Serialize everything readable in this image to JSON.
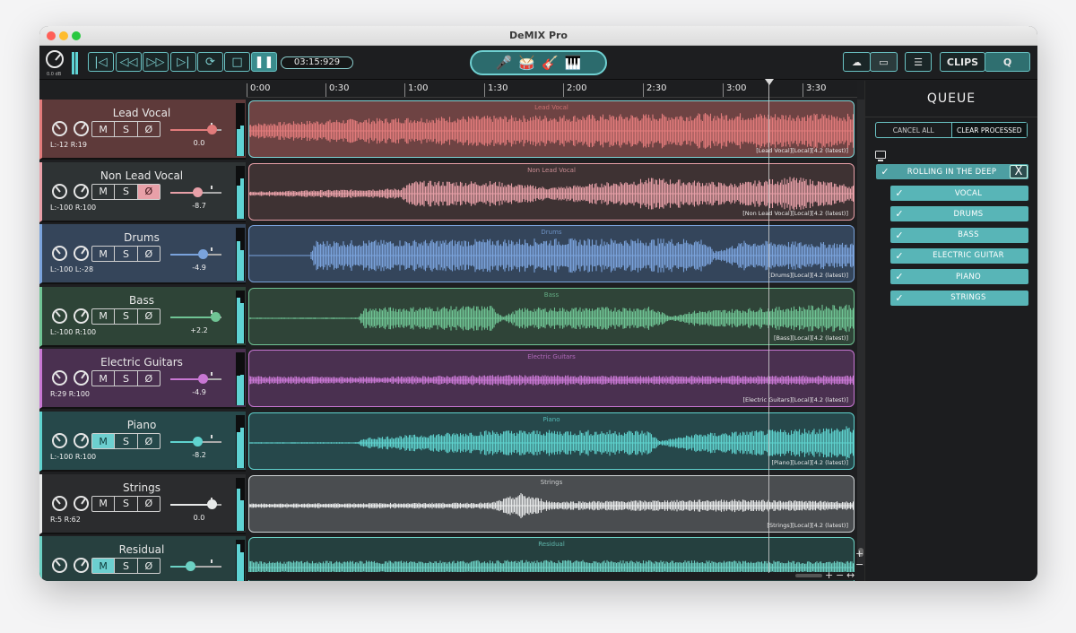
{
  "window": {
    "title": "DeMIX Pro"
  },
  "toolbar": {
    "master_db": "0.0 dB",
    "timecode": "03:15:929",
    "transport": [
      "prev-marker",
      "rewind",
      "fast-forward",
      "next-marker",
      "loop",
      "stop",
      "pause"
    ],
    "instrument_icons": [
      "microphone",
      "drums",
      "guitar",
      "piano"
    ],
    "clips_label": "CLIPS",
    "q_label": "Q"
  },
  "ruler": {
    "ticks": [
      "0:00",
      "0:30",
      "1:00",
      "1:30",
      "2:00",
      "2:30",
      "3:00",
      "3:30"
    ]
  },
  "tracks": [
    {
      "name": "Lead Vocal",
      "lr": "L:-12  R:19",
      "db": "0.0",
      "fader": 0.81,
      "lane_title": "Lead Vocal",
      "lane_tag": "[Lead Vocal][Local][4.2 (latest)]",
      "color": "#e27b7b",
      "bg": "#5e3a3a",
      "laneBg": "#6e4343",
      "border": "#7ed4d6",
      "active_btn": ""
    },
    {
      "name": "Non Lead Vocal",
      "lr": "L:-100  R:100",
      "db": "-8.7",
      "fader": 0.52,
      "lane_title": "Non Lead Vocal",
      "lane_tag": "[Non Lead Vocal][Local][4.2 (latest)]",
      "color": "#e8a0a8",
      "bg": "#2e3334",
      "laneBg": "#3e3233",
      "border": "#e8a0a8",
      "active_btn": "phase"
    },
    {
      "name": "Drums",
      "lr": "L:-100  L:-28",
      "db": "-4.9",
      "fader": 0.63,
      "lane_title": "Drums",
      "lane_tag": "[Drums][Local][4.2 (latest)]",
      "color": "#7aa3dc",
      "bg": "#35455a",
      "laneBg": "#34455b",
      "border": "#7aa3dc",
      "active_btn": ""
    },
    {
      "name": "Bass",
      "lr": "L:-100  R:100",
      "db": "+2.2",
      "fader": 0.88,
      "lane_title": "Bass",
      "lane_tag": "[Bass][Local][4.2 (latest)]",
      "color": "#6fc494",
      "bg": "#2e4437",
      "laneBg": "#2f4438",
      "border": "#6fc494",
      "active_btn": ""
    },
    {
      "name": "Electric Guitars",
      "lr": "R:29  R:100",
      "db": "-4.9",
      "fader": 0.63,
      "lane_title": "Electric Guitars",
      "lane_tag": "[Electric Guitars][Local][4.2 (latest)]",
      "color": "#c877d3",
      "bg": "#4a3050",
      "laneBg": "#4a3050",
      "border": "#c877d3",
      "active_btn": ""
    },
    {
      "name": "Piano",
      "lr": "L:-100  R:100",
      "db": "-8.2",
      "fader": 0.52,
      "lane_title": "Piano",
      "lane_tag": "[Piano][Local][4.2 (latest)]",
      "color": "#5fd3cf",
      "bg": "#26484a",
      "laneBg": "#26484b",
      "border": "#5fd3cf",
      "active_btn": "mute"
    },
    {
      "name": "Strings",
      "lr": "R:5  R:62",
      "db": "0.0",
      "fader": 0.81,
      "lane_title": "Strings",
      "lane_tag": "[Strings][Local][4.2 (latest)]",
      "color": "#e8eaea",
      "bg": "#2b2c2e",
      "laneBg": "#4a4d50",
      "border": "#cfd4d6",
      "active_btn": ""
    },
    {
      "name": "Residual",
      "lr": "",
      "db": "",
      "fader": 0.38,
      "lane_title": "Residual",
      "lane_tag": "",
      "color": "#6cd1c4",
      "bg": "#27403f",
      "laneBg": "#25403f",
      "border": "#6cd1c4",
      "active_btn": "mute"
    }
  ],
  "buttons": {
    "mute": "M",
    "solo": "S",
    "phase": "Ø"
  },
  "queue": {
    "title": "QUEUE",
    "cancel_all": "CANCEL ALL",
    "clear_processed": "CLEAR PROCESSED",
    "song": "ROLLING IN THE DEEP",
    "close": "X",
    "check": "✓",
    "items": [
      "VOCAL",
      "DRUMS",
      "BASS",
      "ELECTRIC GUITAR",
      "PIANO",
      "STRINGS"
    ]
  }
}
